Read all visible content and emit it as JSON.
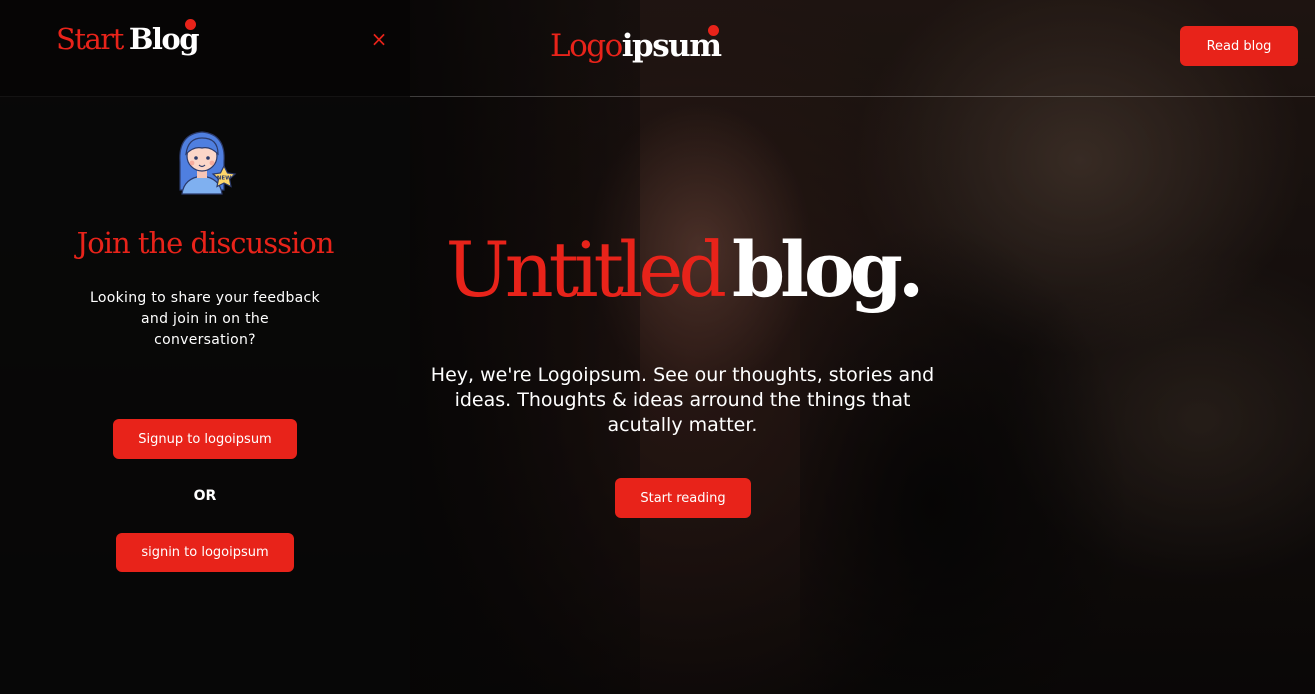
{
  "header": {
    "logo_left": "Logo",
    "logo_right": "ipsum",
    "read_blog_label": "Read blog"
  },
  "hero": {
    "title_red": "Untitled",
    "title_white": "blog.",
    "description": "Hey, we're Logoipsum. See our thoughts, stories and ideas. Thoughts & ideas arround the things that acutally matter.",
    "cta_label": "Start reading"
  },
  "panel": {
    "logo_red": "Start",
    "logo_white": "Blog",
    "close_glyph": "×",
    "avatar_badge": "NEW",
    "title": "Join the discussion",
    "description": "Looking to share your feedback and join in on the conversation?",
    "signup_label": "Signup to logoipsum",
    "or_label": "OR",
    "signin_label": "signin to logoipsum"
  },
  "icons": {
    "close": "close-icon",
    "avatar": "avatar-girl-icon",
    "star": "new-star-badge-icon"
  },
  "colors": {
    "accent": "#e8231a",
    "panel_bg": "#080707",
    "text": "#ffffff"
  }
}
